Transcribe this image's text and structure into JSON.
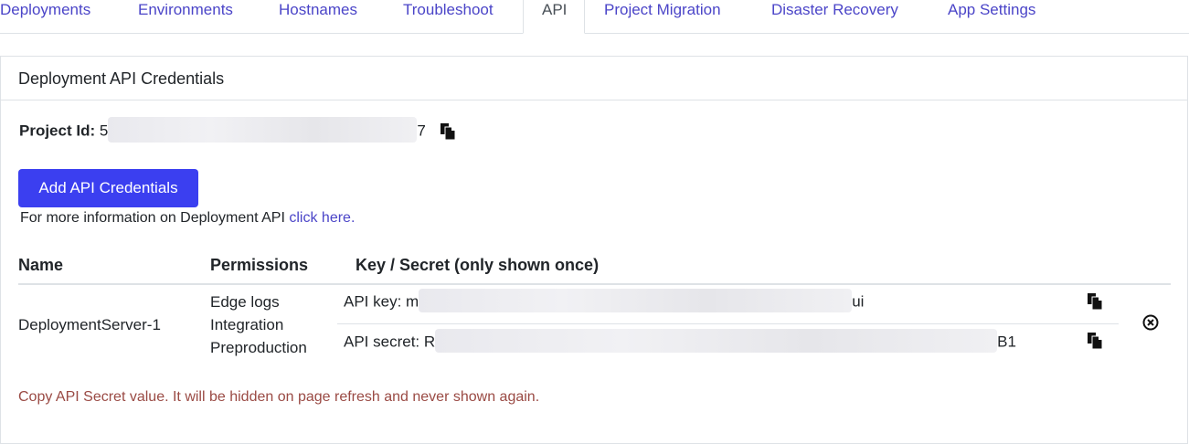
{
  "tabs": [
    {
      "label": "Deployments"
    },
    {
      "label": "Environments"
    },
    {
      "label": "Hostnames"
    },
    {
      "label": "Troubleshoot"
    },
    {
      "label": "API",
      "active": true
    },
    {
      "label": "Project Migration"
    },
    {
      "label": "Disaster Recovery"
    },
    {
      "label": "App Settings"
    }
  ],
  "panel": {
    "title": "Deployment API Credentials",
    "project_label": "Project Id:",
    "project_prefix": "5",
    "project_suffix": "7",
    "add_button": "Add API Credentials",
    "info_text": "For more information on Deployment API ",
    "info_link": "click here.",
    "columns": {
      "name": "Name",
      "permissions": "Permissions",
      "key_secret": "Key / Secret (only shown once)"
    },
    "credential": {
      "name": "DeploymentServer-1",
      "permissions": [
        "Edge logs",
        "Integration",
        "Preproduction"
      ],
      "api_key_label": "API key: m",
      "api_key_suffix": "ui",
      "api_secret_label": "API secret: R",
      "api_secret_suffix": "B1"
    },
    "warning": "Copy API Secret value. It will be hidden on page refresh and never shown again."
  },
  "colors": {
    "accent": "#3b3ff0",
    "link": "#4b45c8",
    "warning": "#9a4a44"
  }
}
